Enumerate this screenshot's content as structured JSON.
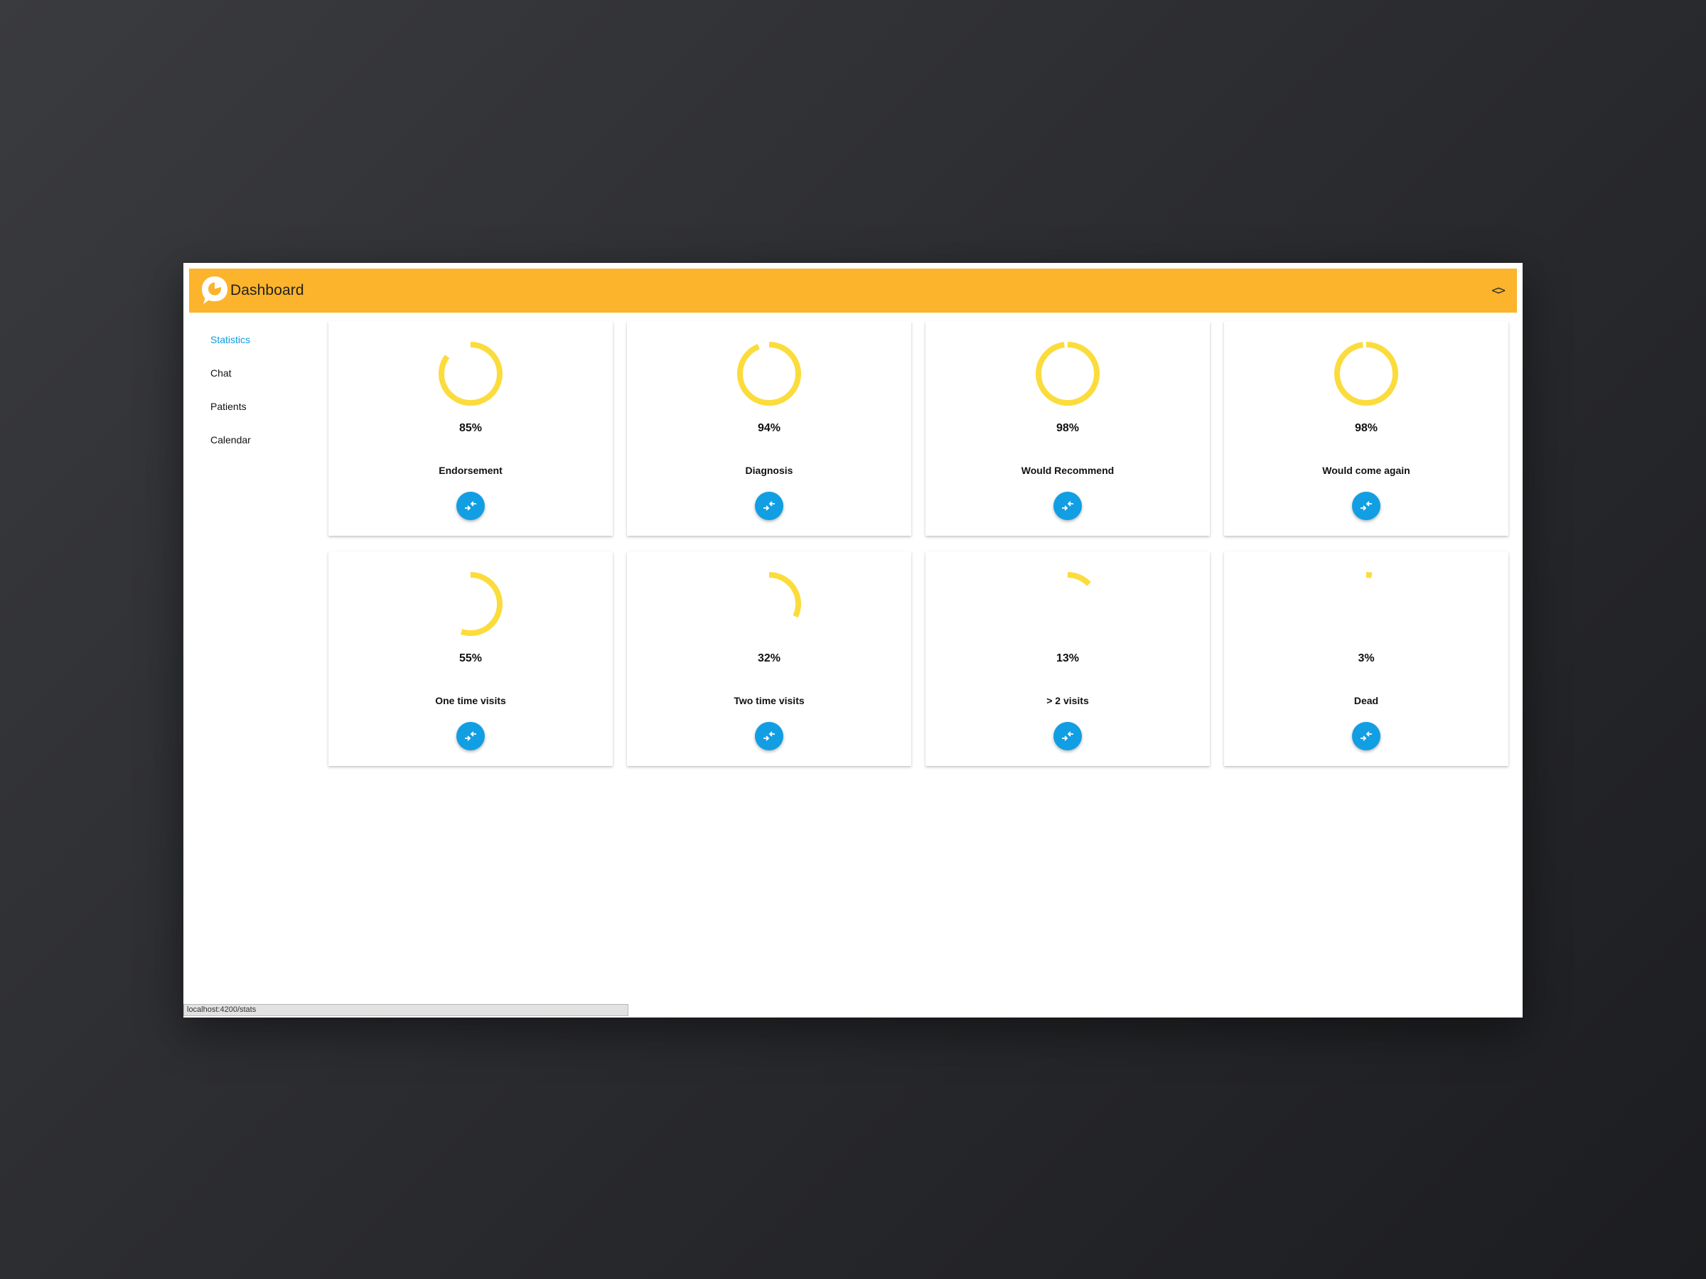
{
  "app": {
    "title": "Dashboard",
    "code_toggle": "<>"
  },
  "sidebar": {
    "items": [
      {
        "label": "Statistics",
        "active": true
      },
      {
        "label": "Chat",
        "active": false
      },
      {
        "label": "Patients",
        "active": false
      },
      {
        "label": "Calendar",
        "active": false
      }
    ]
  },
  "stats": [
    {
      "percent_text": "85%",
      "value": 85,
      "label": "Endorsement"
    },
    {
      "percent_text": "94%",
      "value": 94,
      "label": "Diagnosis"
    },
    {
      "percent_text": "98%",
      "value": 98,
      "label": "Would Recommend"
    },
    {
      "percent_text": "98%",
      "value": 98,
      "label": "Would come again"
    },
    {
      "percent_text": "55%",
      "value": 55,
      "label": "One time visits"
    },
    {
      "percent_text": "32%",
      "value": 32,
      "label": "Two time visits"
    },
    {
      "percent_text": "13%",
      "value": 13,
      "label": "> 2 visits"
    },
    {
      "percent_text": "3%",
      "value": 3,
      "label": "Dead"
    }
  ],
  "status_bar": {
    "url": "localhost:4200/stats"
  },
  "colors": {
    "toolbar": "#fbb42c",
    "ring": "#fbdc3c",
    "active_nav": "#0d9ee0",
    "fab": "#119ee3"
  },
  "icons": {
    "logo": "chat-pie-logo-icon",
    "card_action": "swap-arrows-icon",
    "code_toggle": "code-brackets-icon"
  }
}
